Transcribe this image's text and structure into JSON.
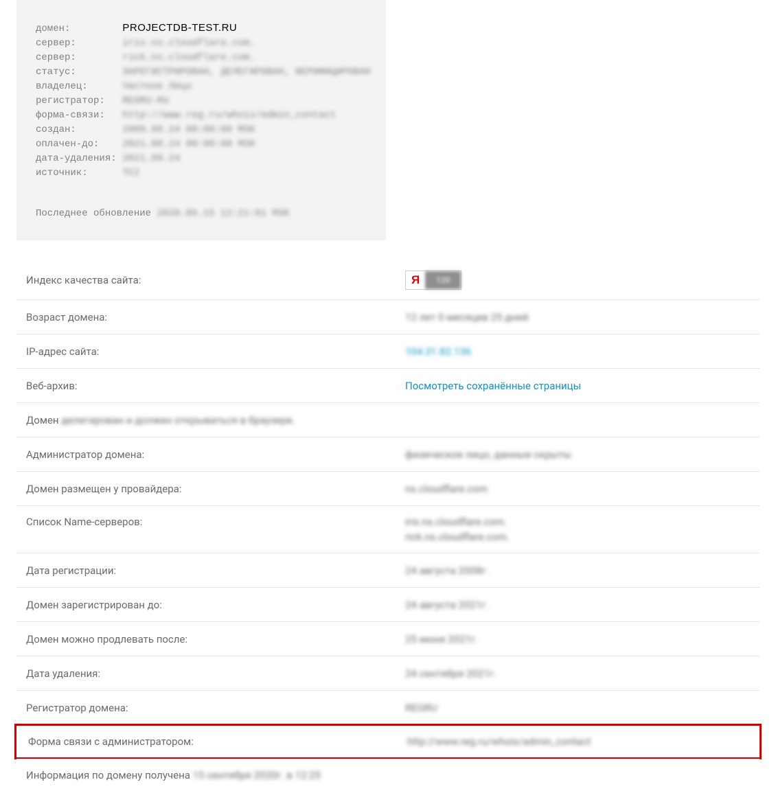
{
  "whois": {
    "domain_label": "домен:",
    "domain_value": "PROJECTDB-TEST.RU",
    "server1_label": "сервер:",
    "server1_value": "iris.ns.cloudflare.com.",
    "server2_label": "сервер:",
    "server2_value": "rick.ns.cloudflare.com.",
    "status_label": "статус:",
    "status_value": "ЗАРЕГИСТРИРОВАН, ДЕЛЕГИРОВАН, ВЕРИФИЦИРОВАН",
    "owner_label": "владелец:",
    "owner_value": "Частное Лицо",
    "registrar_label": "регистратор:",
    "registrar_value": "REGRU-RU",
    "contact_label": "форма-связи:",
    "contact_value": "http://www.reg.ru/whois/admin_contact",
    "created_label": "создан:",
    "created_value": "2008.08.24 00:00:00 MSK",
    "paid_label": "оплачен-до:",
    "paid_value": "2021.08.24 00:00:00 MSK",
    "delete_label": "дата-удаления:",
    "delete_value": "2021.09.24",
    "source_label": "источник:",
    "source_value": "TCI",
    "update_label": "Последнее обновление ",
    "update_value": "2020.09.15 12:21:01 MSK"
  },
  "info": {
    "quality_label": "Индекс качества сайта:",
    "yandex_y": "Я",
    "yandex_value": "120",
    "age_label": "Возраст домена:",
    "age_value": "12 лет 0 месяцев 25 дней",
    "ip_label": "IP-адрес сайта:",
    "ip_value": "104.31.82.136",
    "webarchive_label": "Веб-архив:",
    "webarchive_value": "Посмотреть сохранённые страницы",
    "domain_status_label": "Домен ",
    "domain_status_value": "делегирован и должен открываться в браузере.",
    "admin_label": "Администратор домена:",
    "admin_value": "физическое лицо, данные скрыты",
    "provider_label": "Домен размещен у провайдера:",
    "provider_value": "ns.cloudflare.com",
    "ns_label": "Список Name-серверов:",
    "ns_values": [
      "iris.ns.cloudflare.com.",
      "rick.ns.cloudflare.com."
    ],
    "reg_date_label": "Дата регистрации:",
    "reg_date_value": "24 августа 2008г.",
    "reg_until_label": "Домен зарегистрирован до:",
    "reg_until_value": "24 августа 2021г.",
    "renew_label": "Домен можно продлевать после:",
    "renew_value": "25 июня 2021г.",
    "del_date_label": "Дата удаления:",
    "del_date_value": "24 сентября 2021г.",
    "registrar_label": "Регистратор домена:",
    "registrar_value": "REGRU",
    "contact_label": "Форма связи с администратором:",
    "contact_value": "http://www.reg.ru/whois/admin_contact",
    "final_label": "Информация по домену получена ",
    "final_value": "15 сентября 2020г. в 12:25"
  }
}
